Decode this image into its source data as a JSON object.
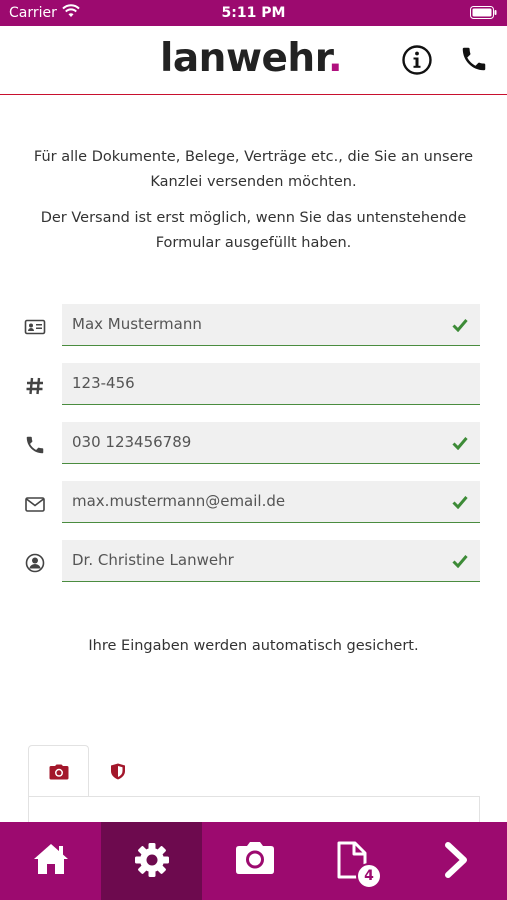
{
  "status_bar": {
    "carrier": "Carrier",
    "time": "5:11 PM"
  },
  "header": {
    "logo_text": "lanwehr",
    "logo_dot": "."
  },
  "intro": {
    "line1": "Für alle Dokumente, Belege, Verträge etc., die Sie an unsere Kanzlei versenden möchten.",
    "line2": "Der Versand ist erst möglich, wenn Sie das untenstehende Formular ausgefüllt haben."
  },
  "form": {
    "fields": [
      {
        "icon": "id-card-icon",
        "value": "Max Mustermann",
        "valid": true
      },
      {
        "icon": "hash-icon",
        "value": "123-456",
        "valid": false
      },
      {
        "icon": "phone-icon",
        "value": "030 123456789",
        "valid": true
      },
      {
        "icon": "envelope-icon",
        "value": "max.mustermann@email.de",
        "valid": true
      },
      {
        "icon": "user-circle-icon",
        "value": "Dr. Christine Lanwehr",
        "valid": true
      }
    ],
    "autosave_note": "Ihre Eingaben werden automatisch gesichert."
  },
  "tabs": [
    {
      "icon": "camera-icon",
      "active": true
    },
    {
      "icon": "shield-icon",
      "active": false
    }
  ],
  "bottom_nav": {
    "items": [
      {
        "icon": "home-icon",
        "active": false
      },
      {
        "icon": "gear-icon",
        "active": true
      },
      {
        "icon": "camera-icon",
        "active": false
      },
      {
        "icon": "document-icon",
        "active": false,
        "badge": "4"
      },
      {
        "icon": "chevron-right-icon",
        "active": false
      }
    ]
  },
  "colors": {
    "brand": "#9c0a6f",
    "brand_dark": "#6d0a4e",
    "accent_line": "#c8102e",
    "valid_green": "#4a8c3f",
    "tab_icon": "#a3172b"
  }
}
